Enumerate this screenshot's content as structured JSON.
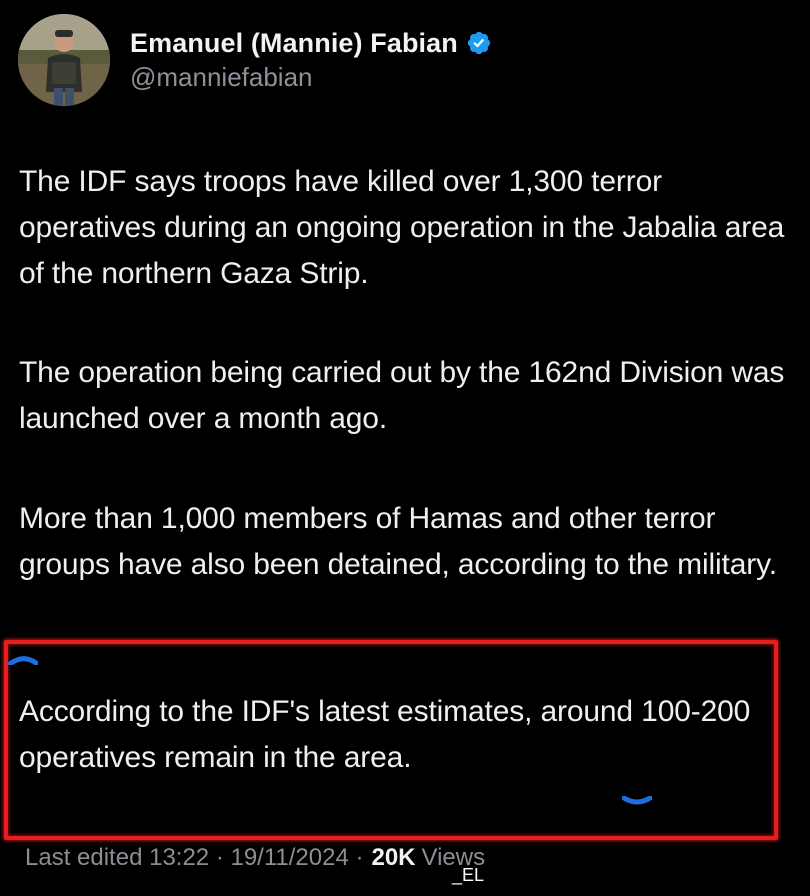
{
  "author": {
    "display_name": "Emanuel (Mannie) Fabian",
    "handle": "@manniefabian",
    "avatar_icon": "user-avatar",
    "verified_icon": "verified-badge-icon",
    "verified_color": "#1d9bf0"
  },
  "tweet": {
    "paragraphs": [
      "The IDF says troops have killed over 1,300 terror operatives during an ongoing operation in the Jabalia area of the northern Gaza Strip.",
      "The operation being carried out by the 162nd Division was launched over a month ago.",
      "More than 1,000 members of Hamas and other terror groups have also been detained, according to the military.",
      "According to the IDF's latest estimates, around 100-200 operatives remain in the area."
    ]
  },
  "meta": {
    "edited_label": "Last edited 13:22 · 19/11/2024 ·",
    "views_count": "20K",
    "views_label": "Views"
  },
  "annotation": {
    "highlight_color": "#e51f1f",
    "marker_color": "#1d6fe0"
  },
  "watermark": {
    "text": "_EL"
  }
}
